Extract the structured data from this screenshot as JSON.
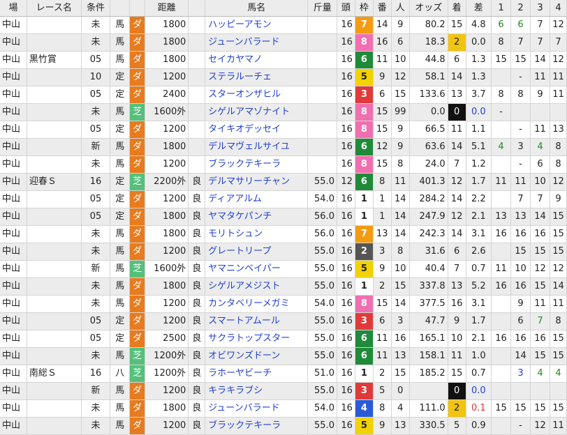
{
  "colors": {
    "dirt": "#e87b1d",
    "turf": "#55c07b",
    "frame_1": "#ffffff",
    "frame_2": "#555555",
    "frame_3": "#e03a3a",
    "frame_4": "#2a5bd7",
    "frame_5": "#f2d200",
    "frame_6": "#1f8a3a",
    "frame_7": "#f39c12",
    "frame_8": "#f06fb0",
    "horse_link": "#1f3fd3",
    "finish_2nd": "#f1c40f"
  },
  "headers": [
    "場",
    "レース名",
    "条件",
    "",
    "",
    "距離",
    "",
    "馬名",
    "斤量",
    "頭",
    "枠",
    "番",
    "人",
    "オッズ",
    "着",
    "差",
    "1",
    "2",
    "3",
    "4"
  ],
  "rows": [
    {
      "track": "中山",
      "race": "",
      "cond": "未",
      "cls": "馬",
      "surface": "ダ",
      "dist": "1800",
      "going": "",
      "horse": "ハッピーアモン",
      "weight": "",
      "heads": "16",
      "frame": "7",
      "num": "14",
      "pop": "9",
      "odds": "80.2",
      "finish": "15",
      "margin": "4.8",
      "c1": "6",
      "c2": "6",
      "c3": "7",
      "c4": "12",
      "c1_style": "green",
      "c2_style": "green",
      "c3_style": "",
      "c4_style": ""
    },
    {
      "track": "中山",
      "race": "",
      "cond": "未",
      "cls": "馬",
      "surface": "ダ",
      "dist": "1800",
      "going": "",
      "horse": "ジューンバラード",
      "weight": "",
      "heads": "16",
      "frame": "8",
      "num": "16",
      "pop": "6",
      "odds": "18.3",
      "finish": "2",
      "margin": "0.0",
      "c1": "8",
      "c2": "7",
      "c3": "7",
      "c4": "7"
    },
    {
      "track": "中山",
      "race": "黒竹賞",
      "cond": "05",
      "cls": "馬",
      "surface": "ダ",
      "dist": "1800",
      "going": "",
      "horse": "セイカヤマノ",
      "weight": "",
      "heads": "16",
      "frame": "6",
      "num": "11",
      "pop": "10",
      "odds": "44.8",
      "finish": "6",
      "margin": "1.3",
      "c1": "15",
      "c2": "15",
      "c3": "14",
      "c4": "12"
    },
    {
      "track": "中山",
      "race": "",
      "cond": "10",
      "cls": "定",
      "surface": "ダ",
      "dist": "1200",
      "going": "",
      "horse": "ステラルーチェ",
      "weight": "",
      "heads": "16",
      "frame": "5",
      "num": "9",
      "pop": "12",
      "odds": "58.1",
      "finish": "14",
      "margin": "1.3",
      "c1": "",
      "c2": "-",
      "c3": "11",
      "c4": "11"
    },
    {
      "track": "中山",
      "race": "",
      "cond": "05",
      "cls": "定",
      "surface": "ダ",
      "dist": "2400",
      "going": "",
      "horse": "スターオンザヒル",
      "weight": "",
      "heads": "16",
      "frame": "3",
      "num": "6",
      "pop": "15",
      "odds": "133.6",
      "finish": "13",
      "margin": "3.7",
      "c1": "8",
      "c2": "8",
      "c3": "9",
      "c4": "11"
    },
    {
      "track": "中山",
      "race": "",
      "cond": "未",
      "cls": "馬",
      "surface": "芝",
      "dist": "1600外",
      "going": "",
      "horse": "シゲルアマゾナイト",
      "weight": "",
      "heads": "16",
      "frame": "8",
      "num": "15",
      "pop": "99",
      "odds": "0.0",
      "finish": "0",
      "margin": "0.0",
      "c1": "-",
      "c2": "",
      "c3": "",
      "c4": ""
    },
    {
      "track": "中山",
      "race": "",
      "cond": "05",
      "cls": "定",
      "surface": "ダ",
      "dist": "1200",
      "going": "",
      "horse": "タイキオデッセイ",
      "weight": "",
      "heads": "16",
      "frame": "8",
      "num": "15",
      "pop": "9",
      "odds": "66.5",
      "finish": "11",
      "margin": "1.1",
      "c1": "",
      "c2": "-",
      "c3": "11",
      "c4": "13"
    },
    {
      "track": "中山",
      "race": "",
      "cond": "新",
      "cls": "馬",
      "surface": "ダ",
      "dist": "1800",
      "going": "",
      "horse": "デルマヴェルサイユ",
      "weight": "",
      "heads": "16",
      "frame": "6",
      "num": "12",
      "pop": "9",
      "odds": "63.6",
      "finish": "14",
      "margin": "5.1",
      "c1": "4",
      "c2": "3",
      "c3": "4",
      "c4": "8"
    },
    {
      "track": "中山",
      "race": "",
      "cond": "未",
      "cls": "馬",
      "surface": "ダ",
      "dist": "1200",
      "going": "",
      "horse": "ブラックテキーラ",
      "weight": "",
      "heads": "16",
      "frame": "8",
      "num": "15",
      "pop": "8",
      "odds": "24.0",
      "finish": "7",
      "margin": "1.2",
      "c1": "",
      "c2": "-",
      "c3": "6",
      "c4": "8"
    },
    {
      "track": "中山",
      "race": "迎春Ｓ",
      "cond": "16",
      "cls": "定",
      "surface": "芝",
      "dist": "2200外",
      "going": "良",
      "horse": "デルマサリーチャン",
      "weight": "55.0",
      "heads": "12",
      "frame": "6",
      "num": "8",
      "pop": "11",
      "odds": "401.3",
      "finish": "12",
      "margin": "1.7",
      "c1": "11",
      "c2": "11",
      "c3": "10",
      "c4": "12"
    },
    {
      "track": "中山",
      "race": "",
      "cond": "05",
      "cls": "定",
      "surface": "ダ",
      "dist": "1200",
      "going": "良",
      "horse": "ディアアルム",
      "weight": "54.0",
      "heads": "16",
      "frame": "1",
      "num": "1",
      "pop": "14",
      "odds": "284.2",
      "finish": "14",
      "margin": "2.2",
      "c1": "",
      "c2": "7",
      "c3": "7",
      "c4": "9"
    },
    {
      "track": "中山",
      "race": "",
      "cond": "05",
      "cls": "定",
      "surface": "ダ",
      "dist": "1800",
      "going": "良",
      "horse": "ヤマタケパンチ",
      "weight": "56.0",
      "heads": "16",
      "frame": "1",
      "num": "1",
      "pop": "14",
      "odds": "247.9",
      "finish": "12",
      "margin": "2.1",
      "c1": "13",
      "c2": "13",
      "c3": "14",
      "c4": "15"
    },
    {
      "track": "中山",
      "race": "",
      "cond": "未",
      "cls": "馬",
      "surface": "ダ",
      "dist": "1800",
      "going": "良",
      "horse": "モリトシュン",
      "weight": "56.0",
      "heads": "16",
      "frame": "7",
      "num": "13",
      "pop": "14",
      "odds": "242.3",
      "finish": "14",
      "margin": "3.1",
      "c1": "16",
      "c2": "16",
      "c3": "16",
      "c4": "15"
    },
    {
      "track": "中山",
      "race": "",
      "cond": "未",
      "cls": "馬",
      "surface": "ダ",
      "dist": "1200",
      "going": "良",
      "horse": "グレートリープ",
      "weight": "55.0",
      "heads": "16",
      "frame": "2",
      "num": "3",
      "pop": "8",
      "odds": "31.6",
      "finish": "6",
      "margin": "2.6",
      "c1": "",
      "c2": "15",
      "c3": "15",
      "c4": "15"
    },
    {
      "track": "中山",
      "race": "",
      "cond": "新",
      "cls": "馬",
      "surface": "芝",
      "dist": "1600外",
      "going": "良",
      "horse": "ヤマニンベイパー",
      "weight": "55.0",
      "heads": "16",
      "frame": "5",
      "num": "9",
      "pop": "10",
      "odds": "40.4",
      "finish": "7",
      "margin": "0.7",
      "c1": "11",
      "c2": "10",
      "c3": "12",
      "c4": "12"
    },
    {
      "track": "中山",
      "race": "",
      "cond": "未",
      "cls": "馬",
      "surface": "ダ",
      "dist": "1800",
      "going": "良",
      "horse": "シゲルアメジスト",
      "weight": "55.0",
      "heads": "16",
      "frame": "1",
      "num": "2",
      "pop": "15",
      "odds": "337.8",
      "finish": "13",
      "margin": "5.2",
      "c1": "16",
      "c2": "16",
      "c3": "15",
      "c4": "14"
    },
    {
      "track": "中山",
      "race": "",
      "cond": "未",
      "cls": "馬",
      "surface": "ダ",
      "dist": "1200",
      "going": "良",
      "horse": "カンタベリーメガミ",
      "weight": "54.0",
      "heads": "16",
      "frame": "8",
      "num": "15",
      "pop": "14",
      "odds": "377.5",
      "finish": "16",
      "margin": "3.1",
      "c1": "",
      "c2": "9",
      "c3": "11",
      "c4": "11"
    },
    {
      "track": "中山",
      "race": "",
      "cond": "05",
      "cls": "定",
      "surface": "ダ",
      "dist": "1200",
      "going": "良",
      "horse": "スマートアムール",
      "weight": "55.0",
      "heads": "16",
      "frame": "3",
      "num": "6",
      "pop": "3",
      "odds": "47.7",
      "finish": "9",
      "margin": "1.7",
      "c1": "",
      "c2": "6",
      "c3": "7",
      "c4": "8"
    },
    {
      "track": "中山",
      "race": "",
      "cond": "05",
      "cls": "定",
      "surface": "ダ",
      "dist": "2500",
      "going": "良",
      "horse": "サクラトップスター",
      "weight": "55.0",
      "heads": "16",
      "frame": "6",
      "num": "11",
      "pop": "16",
      "odds": "165.1",
      "finish": "10",
      "margin": "2.1",
      "c1": "16",
      "c2": "16",
      "c3": "16",
      "c4": "15"
    },
    {
      "track": "中山",
      "race": "",
      "cond": "未",
      "cls": "馬",
      "surface": "芝",
      "dist": "1200外",
      "going": "良",
      "horse": "オビワンズドーン",
      "weight": "55.0",
      "heads": "16",
      "frame": "6",
      "num": "11",
      "pop": "13",
      "odds": "158.1",
      "finish": "11",
      "margin": "1.0",
      "c1": "",
      "c2": "14",
      "c3": "15",
      "c4": "15"
    },
    {
      "track": "中山",
      "race": "南総Ｓ",
      "cond": "16",
      "cls": "八",
      "surface": "芝",
      "dist": "1200外",
      "going": "良",
      "horse": "ラホーヤビーチ",
      "weight": "51.0",
      "heads": "16",
      "frame": "1",
      "num": "2",
      "pop": "15",
      "odds": "185.2",
      "finish": "15",
      "margin": "0.7",
      "c1": "",
      "c2": "3",
      "c3": "4",
      "c4": "4"
    },
    {
      "track": "中山",
      "race": "",
      "cond": "新",
      "cls": "馬",
      "surface": "ダ",
      "dist": "1200",
      "going": "良",
      "horse": "キラキラブシ",
      "weight": "55.0",
      "heads": "16",
      "frame": "3",
      "num": "5",
      "pop": "0",
      "odds": "",
      "finish": "0",
      "margin": "0.0",
      "c1": "",
      "c2": "",
      "c3": "",
      "c4": ""
    },
    {
      "track": "中山",
      "race": "",
      "cond": "未",
      "cls": "馬",
      "surface": "ダ",
      "dist": "1800",
      "going": "良",
      "horse": "ジューンバラード",
      "weight": "54.0",
      "heads": "16",
      "frame": "4",
      "num": "8",
      "pop": "4",
      "odds": "111.0",
      "finish": "2",
      "margin": "0.1",
      "c1": "15",
      "c2": "15",
      "c3": "15",
      "c4": "15"
    },
    {
      "track": "中山",
      "race": "",
      "cond": "未",
      "cls": "馬",
      "surface": "ダ",
      "dist": "1200",
      "going": "良",
      "horse": "ブラックテキーラ",
      "weight": "55.0",
      "heads": "16",
      "frame": "5",
      "num": "9",
      "pop": "13",
      "odds": "330.5",
      "finish": "5",
      "margin": "0.9",
      "c1": "",
      "c2": "-",
      "c3": "12",
      "c4": "11"
    }
  ]
}
